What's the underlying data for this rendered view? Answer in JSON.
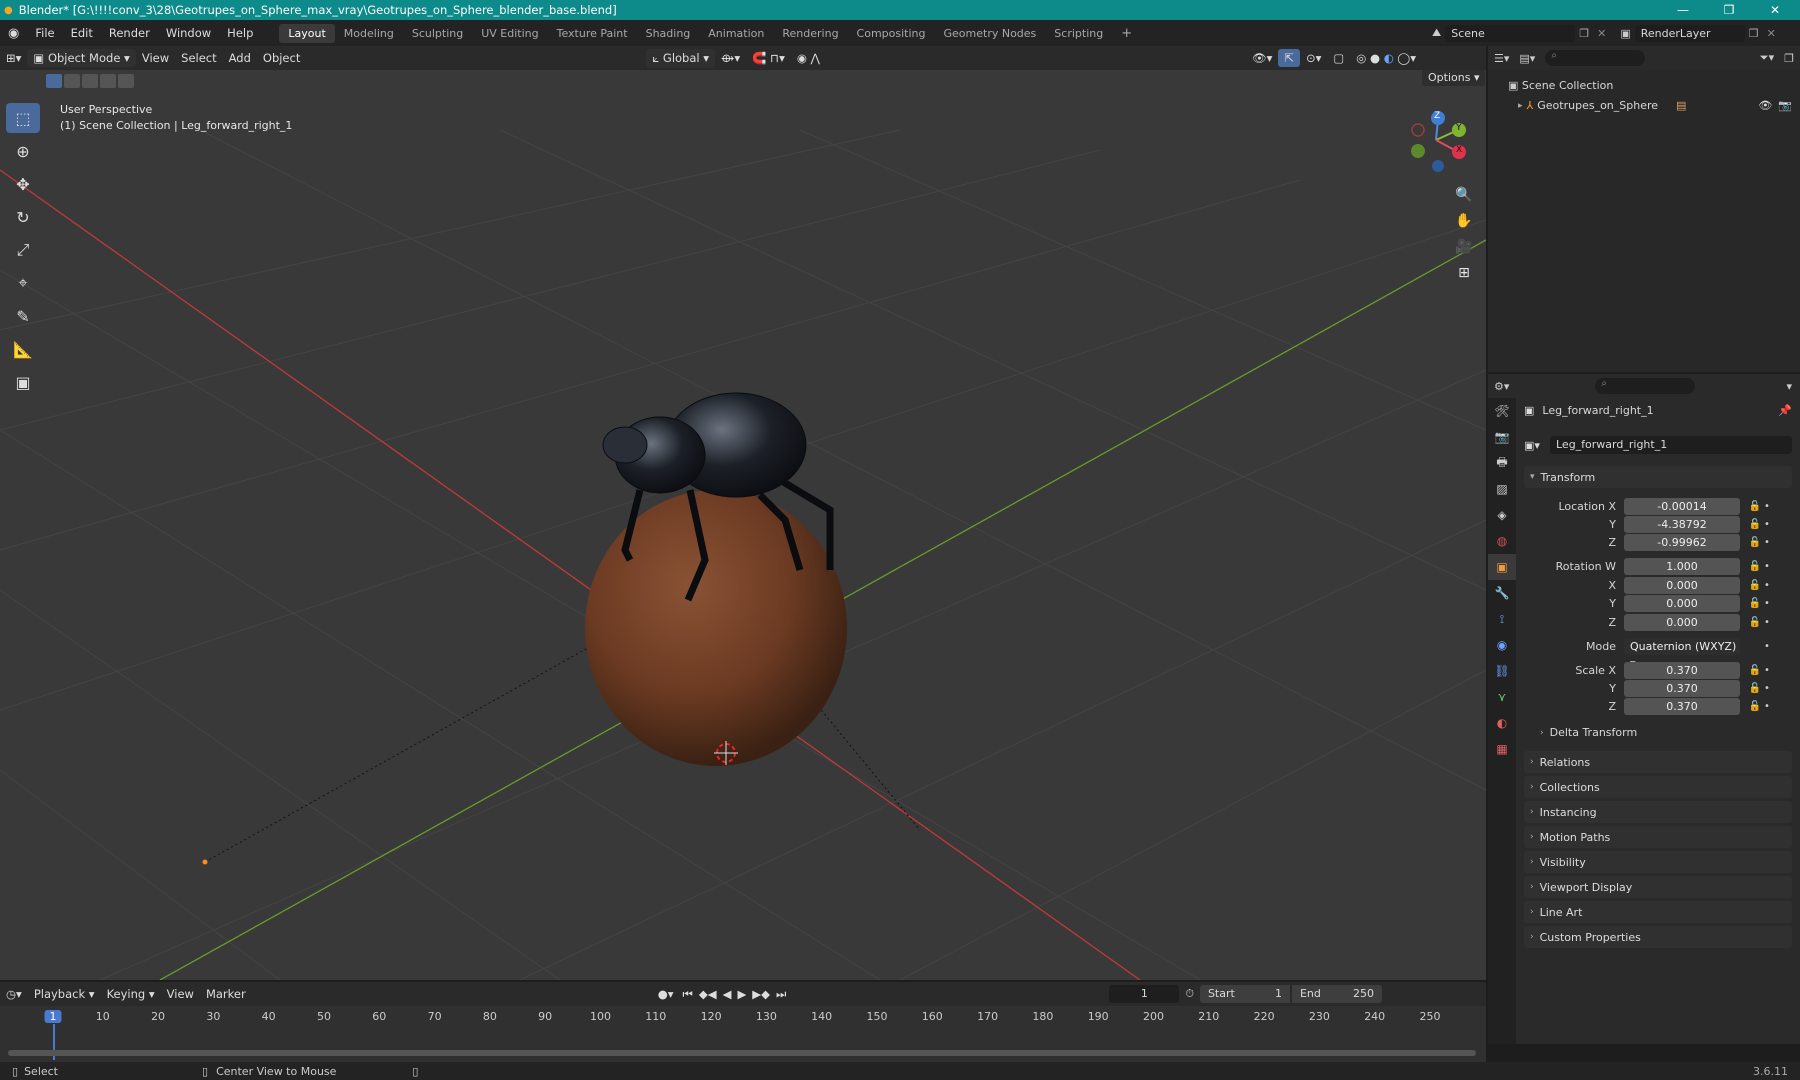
{
  "title_bar": {
    "text": "Blender* [G:\\!!!!conv_3\\28\\Geotrupes_on_Sphere_max_vray\\Geotrupes_on_Sphere_blender_base.blend]",
    "minimize": "—",
    "maximize": "❐",
    "close": "✕"
  },
  "menu": [
    "File",
    "Edit",
    "Render",
    "Window",
    "Help"
  ],
  "workspaces": [
    "Layout",
    "Modeling",
    "Sculpting",
    "UV Editing",
    "Texture Paint",
    "Shading",
    "Animation",
    "Rendering",
    "Compositing",
    "Geometry Nodes",
    "Scripting"
  ],
  "active_workspace": "Layout",
  "scene": {
    "label": "Scene",
    "render_layer": "RenderLayer"
  },
  "viewport_header": {
    "mode": "Object Mode",
    "menus": [
      "View",
      "Select",
      "Add",
      "Object"
    ],
    "orientation": "Global",
    "options": "Options"
  },
  "viewport": {
    "overlay_line1": "User Perspective",
    "overlay_line2": "(1) Scene Collection | Leg_forward_right_1"
  },
  "gizmo": {
    "z": "Z",
    "y": "Y",
    "x": "X"
  },
  "outliner": {
    "collection": "Scene Collection",
    "object": "Geotrupes_on_Sphere"
  },
  "properties": {
    "object_name": "Leg_forward_right_1",
    "data_name": "Leg_forward_right_1",
    "transform_label": "Transform",
    "location": {
      "label": "Location X",
      "x": "-0.00014",
      "y": "-4.38792",
      "z": "-0.99962"
    },
    "rotation": {
      "label": "Rotation W",
      "w": "1.000",
      "x": "0.000",
      "y": "0.000",
      "z": "0.000"
    },
    "mode": {
      "label": "Mode",
      "value": "Quaternion (WXYZ)"
    },
    "scale": {
      "label": "Scale X",
      "x": "0.370",
      "y": "0.370",
      "z": "0.370"
    },
    "axis_labels": {
      "y": "Y",
      "z": "Z",
      "x": "X"
    },
    "delta": "Delta Transform",
    "panels": [
      "Relations",
      "Collections",
      "Instancing",
      "Motion Paths",
      "Visibility",
      "Viewport Display",
      "Line Art",
      "Custom Properties"
    ]
  },
  "timeline": {
    "menus": [
      "Playback",
      "Keying",
      "View",
      "Marker"
    ],
    "current_frame": "1",
    "start_label": "Start",
    "start": "1",
    "end_label": "End",
    "end": "250",
    "ticks": [
      "1",
      "10",
      "20",
      "30",
      "40",
      "50",
      "60",
      "70",
      "80",
      "90",
      "100",
      "110",
      "120",
      "130",
      "140",
      "150",
      "160",
      "170",
      "180",
      "190",
      "200",
      "210",
      "220",
      "230",
      "240",
      "250"
    ]
  },
  "status": {
    "select": "Select",
    "center": "Center View to Mouse",
    "version": "3.6.11"
  },
  "colors": {
    "titlebar": "#0d8a8a",
    "accent": "#4a6a9c",
    "x_axis": "#c0393b",
    "y_axis": "#6a9a2a"
  }
}
